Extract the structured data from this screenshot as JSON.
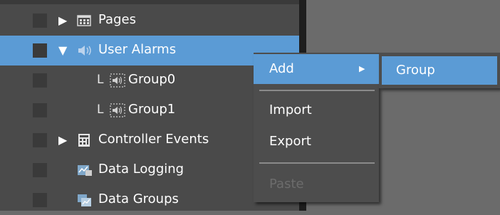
{
  "tree": {
    "items": [
      {
        "label": "Pages",
        "expand": "▶",
        "icon": "pages-icon"
      },
      {
        "label": "User Alarms",
        "expand": "▼",
        "icon": "speaker-icon"
      },
      {
        "label": "Group0",
        "connector": "L",
        "icon": "speaker-group-icon"
      },
      {
        "label": "Group1",
        "connector": "L",
        "icon": "speaker-group-icon"
      },
      {
        "label": "Controller Events",
        "expand": "▶",
        "icon": "controller-events-icon"
      },
      {
        "label": "Data Logging",
        "icon": "data-logging-icon"
      },
      {
        "label": "Data Groups",
        "icon": "data-groups-icon"
      }
    ],
    "selected": "User Alarms"
  },
  "context_menu": {
    "add": "Add",
    "add_arrow": "▶",
    "import": "Import",
    "export": "Export",
    "paste": "Paste"
  },
  "submenu": {
    "group": "Group"
  },
  "colors": {
    "selection": "#5b9bd5",
    "panel": "#4a4a4a",
    "menu": "#4d4d4d",
    "disabled_text": "#6c6c6c"
  }
}
